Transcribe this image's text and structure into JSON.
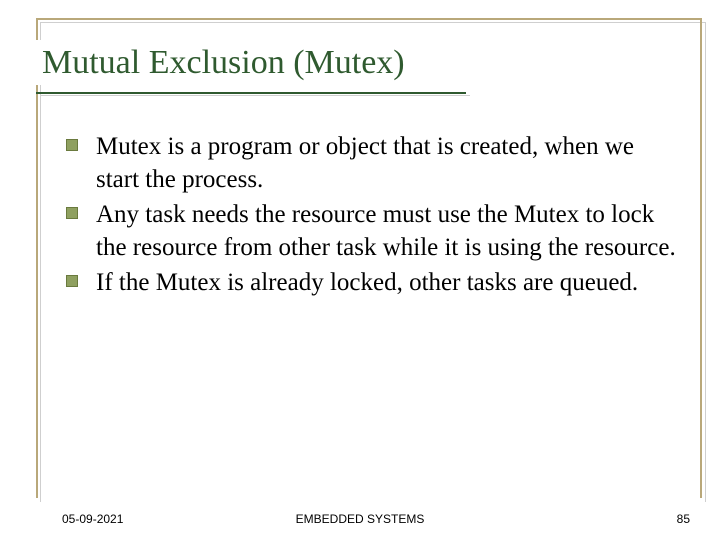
{
  "title": "Mutual Exclusion (Mutex)",
  "bullets": [
    "Mutex is a program or object that is created, when we start the process.",
    "Any task needs the resource must use the Mutex to lock the resource from other task while it is using the resource.",
    "If the Mutex is already locked, other tasks are queued."
  ],
  "footer": {
    "date": "05-09-2021",
    "center": "EMBEDDED SYSTEMS",
    "page": "85"
  }
}
